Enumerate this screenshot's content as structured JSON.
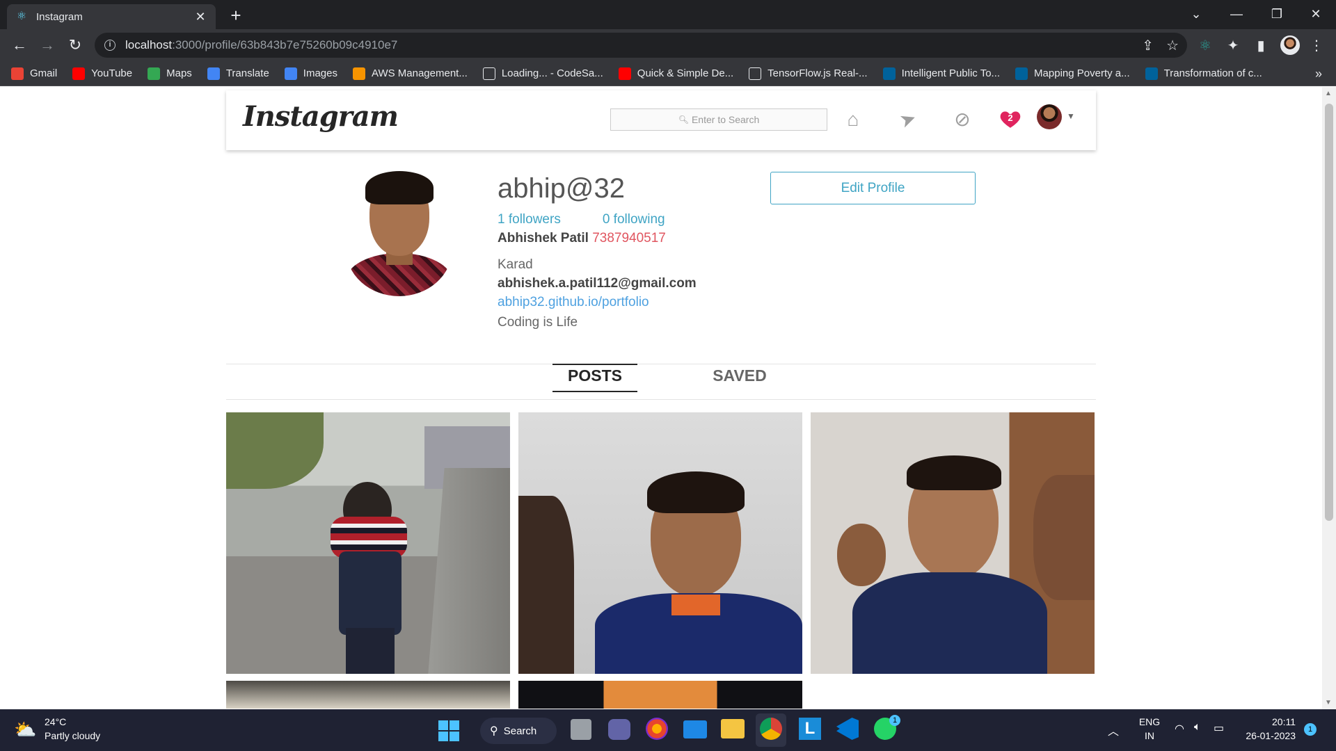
{
  "browser": {
    "tab_title": "Instagram",
    "url_host": "localhost",
    "url_path": ":3000/profile/63b843b7e75260b09c4910e7"
  },
  "bookmarks": [
    {
      "label": "Gmail",
      "icon": "gmail-icon",
      "color": "#ea4335"
    },
    {
      "label": "YouTube",
      "icon": "youtube-icon",
      "color": "#ff0000"
    },
    {
      "label": "Maps",
      "icon": "maps-icon",
      "color": "#34a853"
    },
    {
      "label": "Translate",
      "icon": "translate-icon",
      "color": "#4285f4"
    },
    {
      "label": "Images",
      "icon": "google-icon",
      "color": "#4285f4"
    },
    {
      "label": "AWS Management...",
      "icon": "aws-icon",
      "color": "#f79400"
    },
    {
      "label": "Loading... - CodeSa...",
      "icon": "page-icon",
      "color": "transparent"
    },
    {
      "label": "Quick & Simple De...",
      "icon": "youtube-icon",
      "color": "#ff0000"
    },
    {
      "label": "TensorFlow.js Real-...",
      "icon": "page-icon",
      "color": "transparent"
    },
    {
      "label": "Intelligent Public To...",
      "icon": "ieee-icon",
      "color": "#00629b"
    },
    {
      "label": "Mapping Poverty a...",
      "icon": "ieee-icon",
      "color": "#00629b"
    },
    {
      "label": "Transformation of c...",
      "icon": "ieee-icon",
      "color": "#00629b"
    }
  ],
  "nav": {
    "logo": "Instagram",
    "search_placeholder": "Enter to Search",
    "notification_count": "2"
  },
  "profile": {
    "username": "abhip@32",
    "followers": "1 followers",
    "following": "0 following",
    "full_name": "Abhishek Patil",
    "phone": "7387940517",
    "city": "Karad",
    "email": "abhishek.a.patil112@gmail.com",
    "website": "abhip32.github.io/portfolio",
    "bio": "Coding is Life",
    "edit_label": "Edit Profile"
  },
  "tabs": {
    "posts": "POSTS",
    "saved": "SAVED"
  },
  "posts": [
    {
      "alt": "two friends piggyback on road"
    },
    {
      "alt": "selfie in blue jersey"
    },
    {
      "alt": "group selfie indoors"
    },
    {
      "alt": "notebook photo"
    },
    {
      "alt": "cricket photo"
    }
  ],
  "taskbar": {
    "temp": "24°C",
    "weather": "Partly cloudy",
    "search_label": "Search",
    "lang": "ENG",
    "region": "IN",
    "time": "20:11",
    "date": "26-01-2023",
    "whatsapp_badge": "1",
    "notif_badge": "1"
  },
  "colors": {
    "accent": "#3fa4c4",
    "phone": "#e0555f",
    "link": "#4ea1e0",
    "heart": "#e0245e"
  }
}
